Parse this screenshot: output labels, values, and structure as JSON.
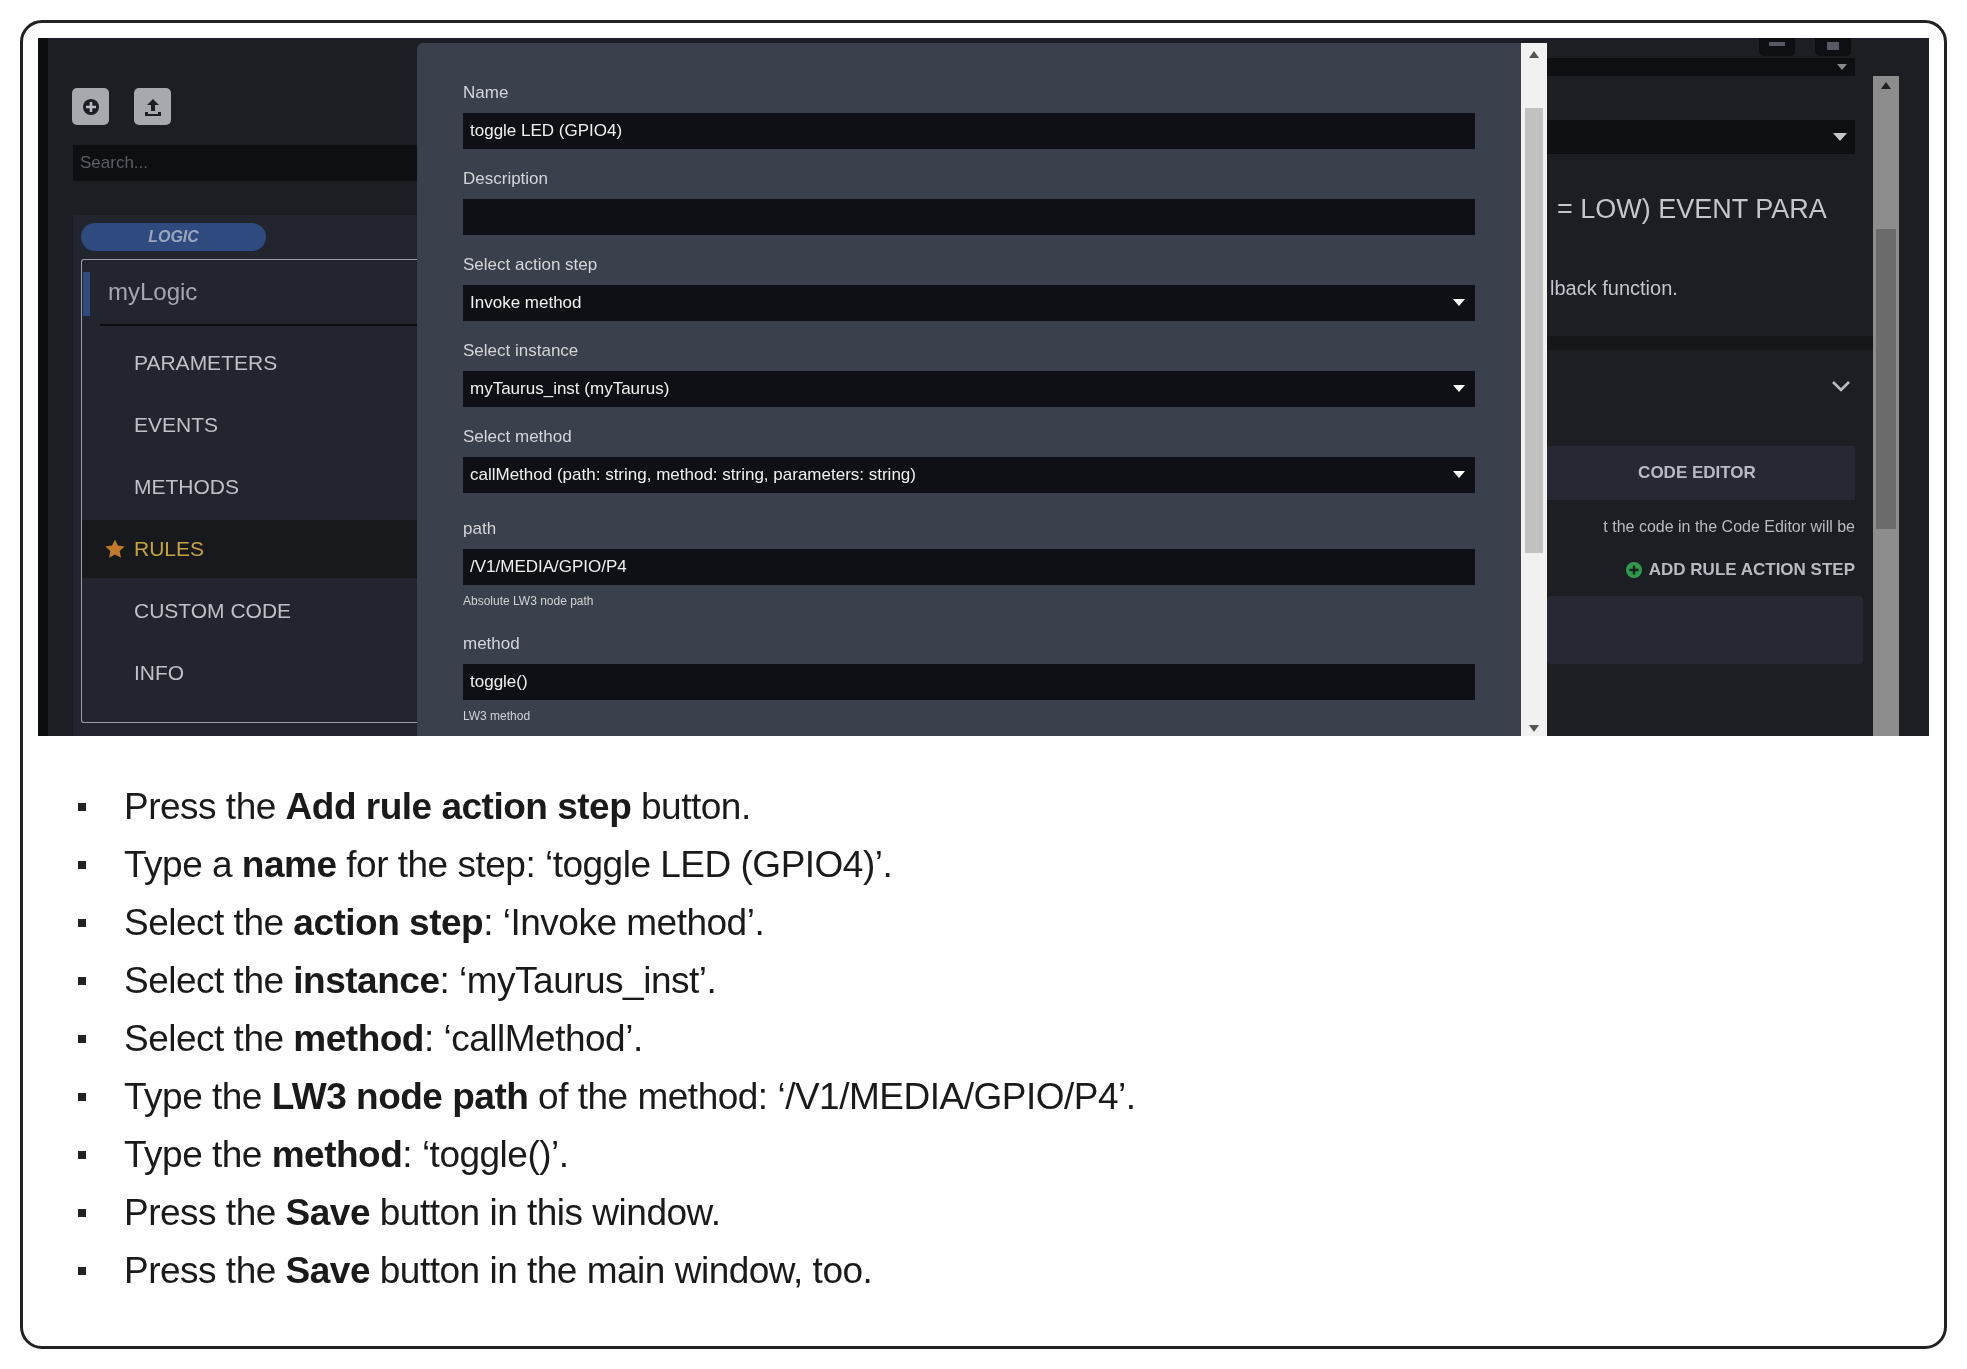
{
  "sidebar": {
    "search": {
      "placeholder": "Search..."
    },
    "badge": "LOGIC",
    "logic_name": "myLogic",
    "items": [
      {
        "label": "PARAMETERS",
        "selected": false
      },
      {
        "label": "EVENTS",
        "selected": false
      },
      {
        "label": "METHODS",
        "selected": false
      },
      {
        "label": "RULES",
        "selected": true
      },
      {
        "label": "CUSTOM CODE",
        "selected": false
      },
      {
        "label": "INFO",
        "selected": false
      }
    ]
  },
  "dialog": {
    "fields": [
      {
        "label": "Name",
        "kind": "text",
        "value": "toggle LED (GPIO4)"
      },
      {
        "label": "Description",
        "kind": "text"
      },
      {
        "label": "Select action step",
        "kind": "select",
        "value": "Invoke method"
      },
      {
        "label": "Select instance",
        "kind": "select",
        "value": "myTaurus_inst (myTaurus)"
      },
      {
        "label": "Select method",
        "kind": "select",
        "value": "callMethod (path: string, method: string, parameters: string)"
      },
      {
        "label": "path",
        "kind": "text",
        "value": "/V1/MEDIA/GPIO/P4",
        "hint": "Absolute LW3 node path"
      },
      {
        "label": "method",
        "kind": "text",
        "value": "toggle()",
        "hint": "LW3 method"
      }
    ]
  },
  "background_panel": {
    "heading": "= LOW) EVENT PARA",
    "description": "lback function.",
    "code_editor_button": "CODE EDITOR",
    "note": "t the code in the Code Editor will be",
    "add_step_button": "ADD RULE ACTION STEP"
  },
  "instructions": [
    "Press the **Add rule action step** button.",
    "Type a **name** for the step: ‘toggle LED (GPIO4)’.",
    "Select the **action step**: ‘Invoke method’.",
    "Select the **instance**: ‘myTaurus_inst’.",
    "Select the **method**: ‘callMethod’.",
    "Type the **LW3 node path** of the method: ‘/V1/MEDIA/GPIO/P4’.",
    "Type the **method**: ‘toggle()’.",
    "Press the **Save** button in this window.",
    "Press the **Save** button in the main window, too."
  ]
}
